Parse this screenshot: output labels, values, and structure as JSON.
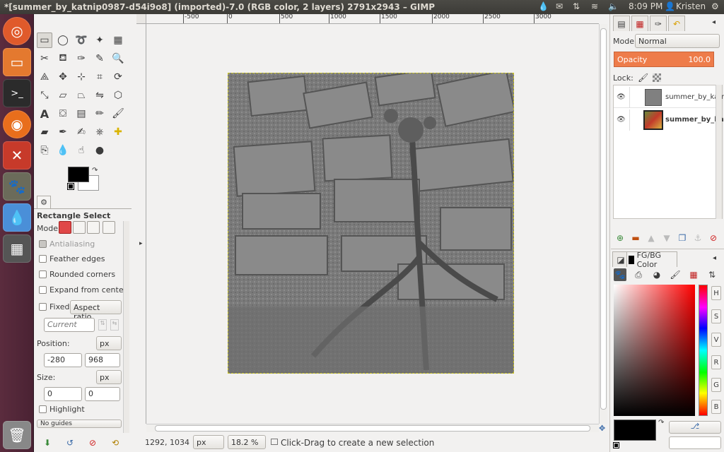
{
  "window": {
    "title": "*[summer_by_katnip0987-d54i9o8] (imported)-7.0 (RGB color, 2 layers) 2791x2943 – GIMP"
  },
  "tray": {
    "time": "8:09 PM",
    "user": "Kristen"
  },
  "launcher": {
    "items": [
      "dash-home",
      "files",
      "terminal",
      "firefox",
      "system-settings",
      "gimp",
      "drop",
      "workspaces",
      "trash"
    ]
  },
  "tool_options": {
    "tool_name": "Rectangle Select",
    "mode_label": "Mode:",
    "antialiasing": "Antialiasing",
    "feather_edges": "Feather edges",
    "rounded_corners": "Rounded corners",
    "expand_from_center": "Expand from center",
    "fixed_label": "Fixed:",
    "fixed_value": "Aspect ratio",
    "current_value": "Current",
    "position_label": "Position:",
    "position_unit": "px",
    "position_x": "-280",
    "position_y": "968",
    "size_label": "Size:",
    "size_unit": "px",
    "size_w": "0",
    "size_h": "0",
    "highlight": "Highlight",
    "guides": "No guides"
  },
  "ruler": {
    "top_ticks": [
      "-500",
      "0",
      "500",
      "1000",
      "1500",
      "2000",
      "2500",
      "3000"
    ]
  },
  "statusbar": {
    "coords": "1292, 1034",
    "unit": "px",
    "zoom": "18.2 %",
    "message": "Click-Drag to create a new selection"
  },
  "layers_dock": {
    "mode_label": "Mode:",
    "mode_value": "Normal",
    "opacity_label": "Opacity",
    "opacity_value": "100.0",
    "lock_label": "Lock:",
    "layers": [
      {
        "name": "summer_by_katni"
      },
      {
        "name": "summer_by_katn"
      }
    ]
  },
  "color_dock": {
    "title": "FG/BG Color",
    "channels": [
      "H",
      "S",
      "V",
      "R",
      "G",
      "B"
    ]
  },
  "colors": {
    "fg": "#000000",
    "bg": "#ffffff",
    "opacity_accent": "#ee7c4a"
  }
}
